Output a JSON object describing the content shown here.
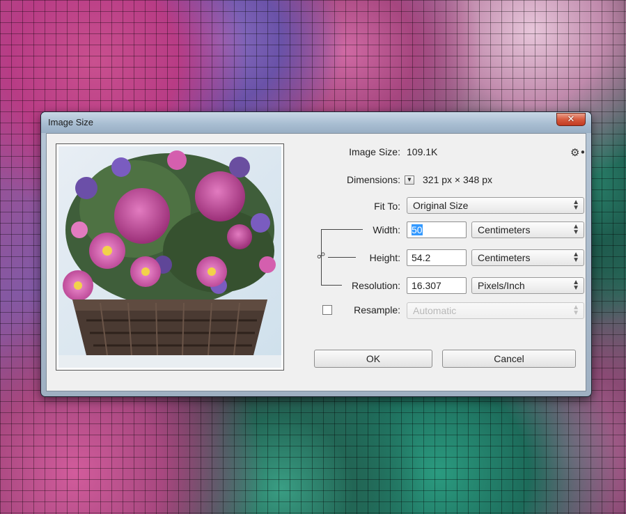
{
  "window": {
    "title": "Image Size",
    "close_glyph": "✕"
  },
  "info": {
    "image_size_label": "Image Size:",
    "image_size_value": "109.1K",
    "dimensions_label": "Dimensions:",
    "dimensions_value": "321 px  ×  348 px"
  },
  "fit_to": {
    "label": "Fit To:",
    "value": "Original Size"
  },
  "width": {
    "label": "Width:",
    "value": "50",
    "unit": "Centimeters"
  },
  "height": {
    "label": "Height:",
    "value": "54.2",
    "unit": "Centimeters"
  },
  "resolution": {
    "label": "Resolution:",
    "value": "16.307",
    "unit": "Pixels/Inch"
  },
  "resample": {
    "label": "Resample:",
    "value": "Automatic",
    "checked": false
  },
  "buttons": {
    "ok": "OK",
    "cancel": "Cancel"
  },
  "icons": {
    "gear": "gear-icon",
    "chain": "chain-link-icon",
    "close": "close-icon",
    "dropdown": "dropdown-arrows-icon"
  },
  "colors": {
    "selection": "#3399ff",
    "close_button": "#d14a2d",
    "dialog_bg": "#f0f0f0"
  }
}
